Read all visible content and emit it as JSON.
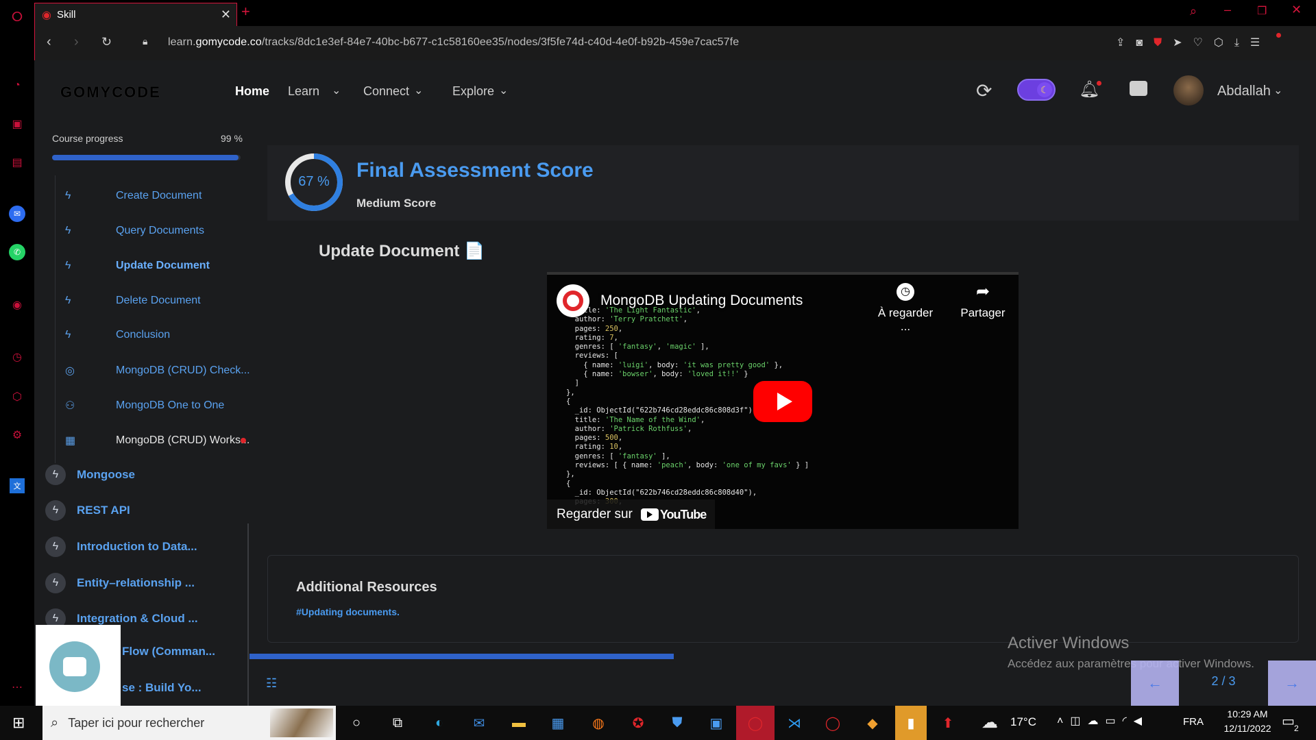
{
  "browser": {
    "tab_title": "Skill",
    "url_prefix": "learn.",
    "url_domain": "gomycode.co",
    "url_path": "/tracks/8dc1e3ef-84e7-40bc-b677-c1c58160ee35/nodes/3f5fe74d-c40d-4e0f-b92b-459e7cac57fe"
  },
  "header": {
    "logo": "GOMYCODE",
    "nav": [
      "Home",
      "Learn",
      "Connect",
      "Explore"
    ],
    "user_name": "Abdallah"
  },
  "sidebar": {
    "progress_label": "Course progress",
    "progress_text": "99 %",
    "progress_value": 0.99,
    "lessons": [
      {
        "label": "Create Document",
        "icon": "bolt-icon"
      },
      {
        "label": "Query Documents",
        "icon": "bolt-icon"
      },
      {
        "label": "Update Document",
        "icon": "bolt-icon",
        "active": true
      },
      {
        "label": "Delete Document",
        "icon": "bolt-icon"
      },
      {
        "label": "Conclusion",
        "icon": "bolt-icon"
      },
      {
        "label": "MongoDB (CRUD) Check...",
        "icon": "target-icon"
      },
      {
        "label": "MongoDB One to One",
        "icon": "people-icon"
      },
      {
        "label": "MongoDB (CRUD) Works...",
        "icon": "workshop-icon"
      }
    ],
    "modules": [
      "Mongoose",
      "REST API",
      "Introduction to Data...",
      "Entity–relationship ...",
      "Integration & Cloud ...",
      "Flow (Comman...",
      "se : Build Yo..."
    ]
  },
  "score": {
    "percent_text": "67 %",
    "percent_value": 0.67,
    "title": "Final Assessment Score",
    "subtitle": "Medium Score"
  },
  "lesson": {
    "title": "Update Document 📄",
    "video": {
      "title": "MongoDB Updating Documents",
      "watch_later": "À regarder ...",
      "share": "Partager",
      "watch_on": "Regarder sur",
      "youtube": "YouTube",
      "code_lines": [
        "  title: 'The Light Fantastic',",
        "  author: 'Terry Pratchett',",
        "  pages: 250,",
        "  rating: 7,",
        "  genres: [ 'fantasy', 'magic' ],",
        "  reviews: [",
        "    { name: 'luigi', body: 'it was pretty good' },",
        "    { name: 'bowser', body: 'loved it!!' }",
        "  ]",
        "},",
        "{",
        "  _id: ObjectId(\"622b746cd28eddc86c808d3f\"),",
        "  title: 'The Name of the Wind',",
        "  author: 'Patrick Rothfuss',",
        "  pages: 500,",
        "  rating: 10,",
        "  genres: [ 'fantasy' ],",
        "  reviews: [ { name: 'peach', body: 'one of my favs' } ]",
        "},",
        "{",
        "  _id: ObjectId(\"622b746cd28eddc86c808d40\"),",
        "  pages: 300,"
      ]
    }
  },
  "resources": {
    "title": "Additional Resources",
    "link": "#Updating documents."
  },
  "pager": {
    "text": "2 / 3",
    "progress_value": 0.52
  },
  "watermark": {
    "line1": "Activer Windows",
    "line2": "Accédez aux paramètres pour activer Windows."
  },
  "taskbar": {
    "search_placeholder": "Taper ici pour rechercher",
    "weather": "17°C",
    "lang": "FRA",
    "time": "10:29 AM",
    "date": "12/11/2022",
    "notif_count": "2"
  },
  "colors": {
    "accent": "#2f7fe0",
    "brand_red": "#e0262b",
    "opera_red": "#d5153c",
    "youtube_red": "#ff0000",
    "pager_bg": "#b4b2f0"
  }
}
